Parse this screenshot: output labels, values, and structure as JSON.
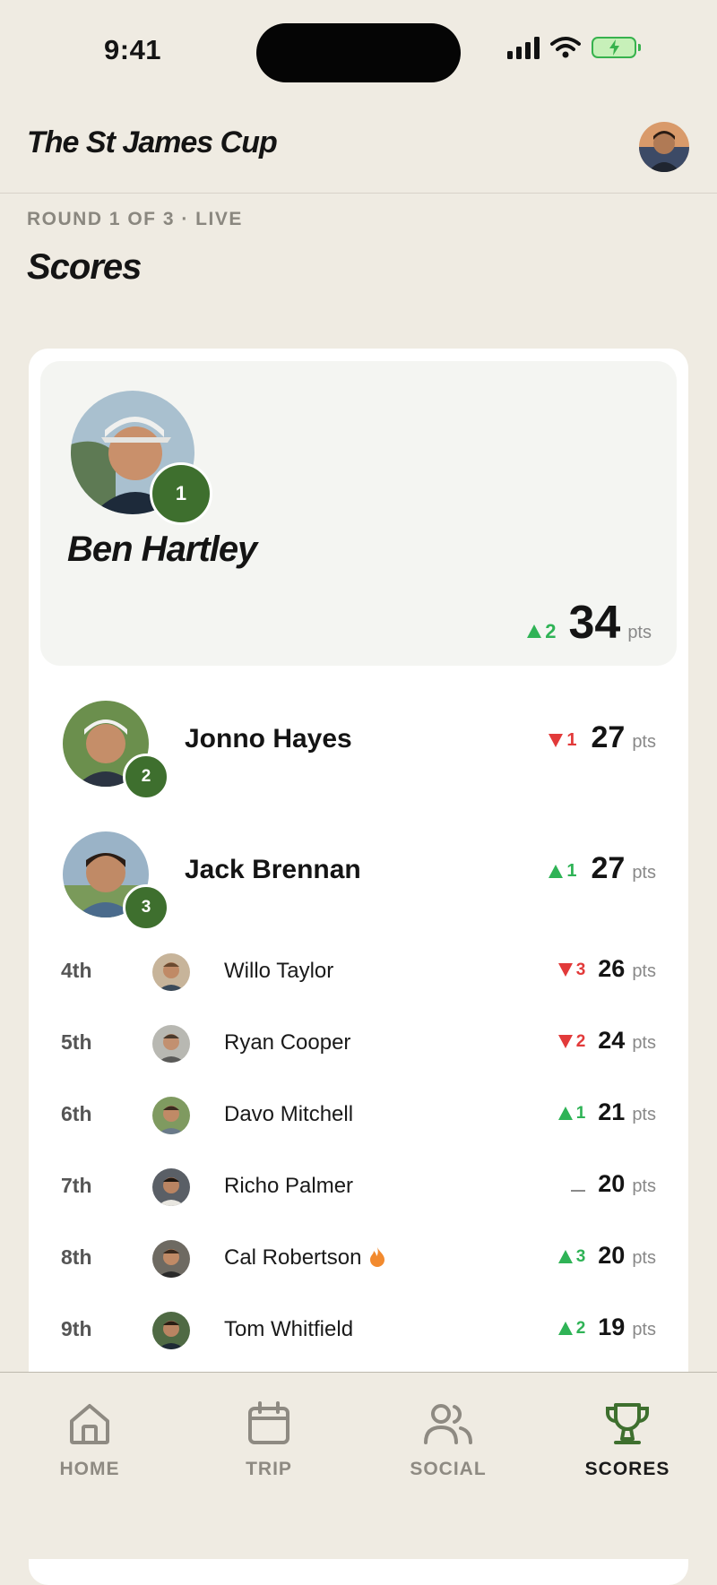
{
  "status_bar": {
    "time": "9:41"
  },
  "header": {
    "title": "The St James Cup"
  },
  "round_label": "ROUND 1 OF 3 · LIVE",
  "page_title": "Scores",
  "pts_label": "pts",
  "leader": {
    "rank": "1",
    "name": "Ben Hartley",
    "movement": "2",
    "movement_dir": "up",
    "points": "34"
  },
  "podium": [
    {
      "rank": "2",
      "name": "Jonno Hayes",
      "movement": "1",
      "movement_dir": "down",
      "points": "27"
    },
    {
      "rank": "3",
      "name": "Jack Brennan",
      "movement": "1",
      "movement_dir": "up",
      "points": "27"
    }
  ],
  "rows": [
    {
      "rank": "4th",
      "name": "Willo Taylor",
      "movement": "3",
      "movement_dir": "down",
      "points": "26"
    },
    {
      "rank": "5th",
      "name": "Ryan Cooper",
      "movement": "2",
      "movement_dir": "down",
      "points": "24"
    },
    {
      "rank": "6th",
      "name": "Davo Mitchell",
      "movement": "1",
      "movement_dir": "up",
      "points": "21"
    },
    {
      "rank": "7th",
      "name": "Richo Palmer",
      "movement": "",
      "movement_dir": "same",
      "points": "20"
    },
    {
      "rank": "8th",
      "name": "Cal Robertson",
      "movement": "3",
      "movement_dir": "up",
      "points": "20",
      "hot": true
    },
    {
      "rank": "9th",
      "name": "Tom Whitfield",
      "movement": "2",
      "movement_dir": "up",
      "points": "19"
    }
  ],
  "tabs": [
    {
      "label": "HOME",
      "icon": "home-icon"
    },
    {
      "label": "TRIP",
      "icon": "calendar-icon"
    },
    {
      "label": "SOCIAL",
      "icon": "people-icon"
    },
    {
      "label": "SCORES",
      "icon": "trophy-icon",
      "active": true
    }
  ],
  "colors": {
    "background": "#efebe2",
    "accent_green": "#3e6f2e",
    "up": "#2fb356",
    "down": "#e23a3a"
  }
}
